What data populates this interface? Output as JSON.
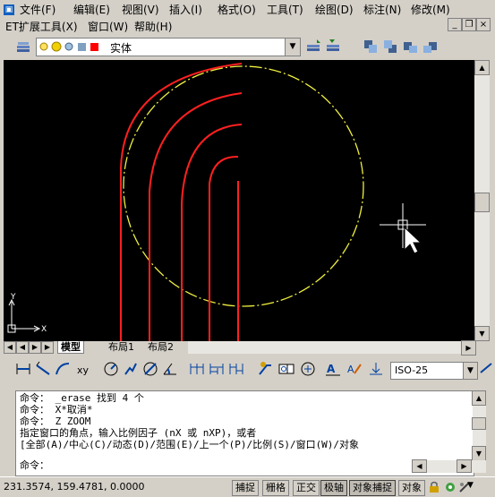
{
  "menu": {
    "row1": [
      "文件(F)",
      "编辑(E)",
      "视图(V)",
      "插入(I)",
      "格式(O)",
      "工具(T)",
      "绘图(D)",
      "标注(N)",
      "修改(M)"
    ],
    "row2": [
      "ET扩展工具(X)",
      "窗口(W)",
      "帮助(H)"
    ]
  },
  "layer": {
    "current": "实体"
  },
  "tabs": [
    "模型",
    "布局1",
    "布局2"
  ],
  "dimstyle": "ISO-25",
  "ucs": {
    "y": "Y",
    "x": "X"
  },
  "command": {
    "lines": [
      "命令： _erase 找到 4 个",
      "命令： X*取消*",
      "命令： Z ZOOM",
      "指定窗口的角点，输入比例因子 (nX 或 nXP)，或者",
      "[全部(A)/中心(C)/动态(D)/范围(E)/上一个(P)/比例(S)/窗口(W)/对象"
    ],
    "prompt": "命令："
  },
  "status": {
    "coords": "231.3574, 159.4781, 0.0000",
    "buttons": [
      "捕捉",
      "栅格",
      "正交",
      "极轴",
      "对象捕捉",
      "对象"
    ]
  },
  "colors": {
    "canvas": "#000000",
    "red": "#ff2020",
    "yellow": "#f0f040",
    "ui": "#d4d0c8"
  }
}
